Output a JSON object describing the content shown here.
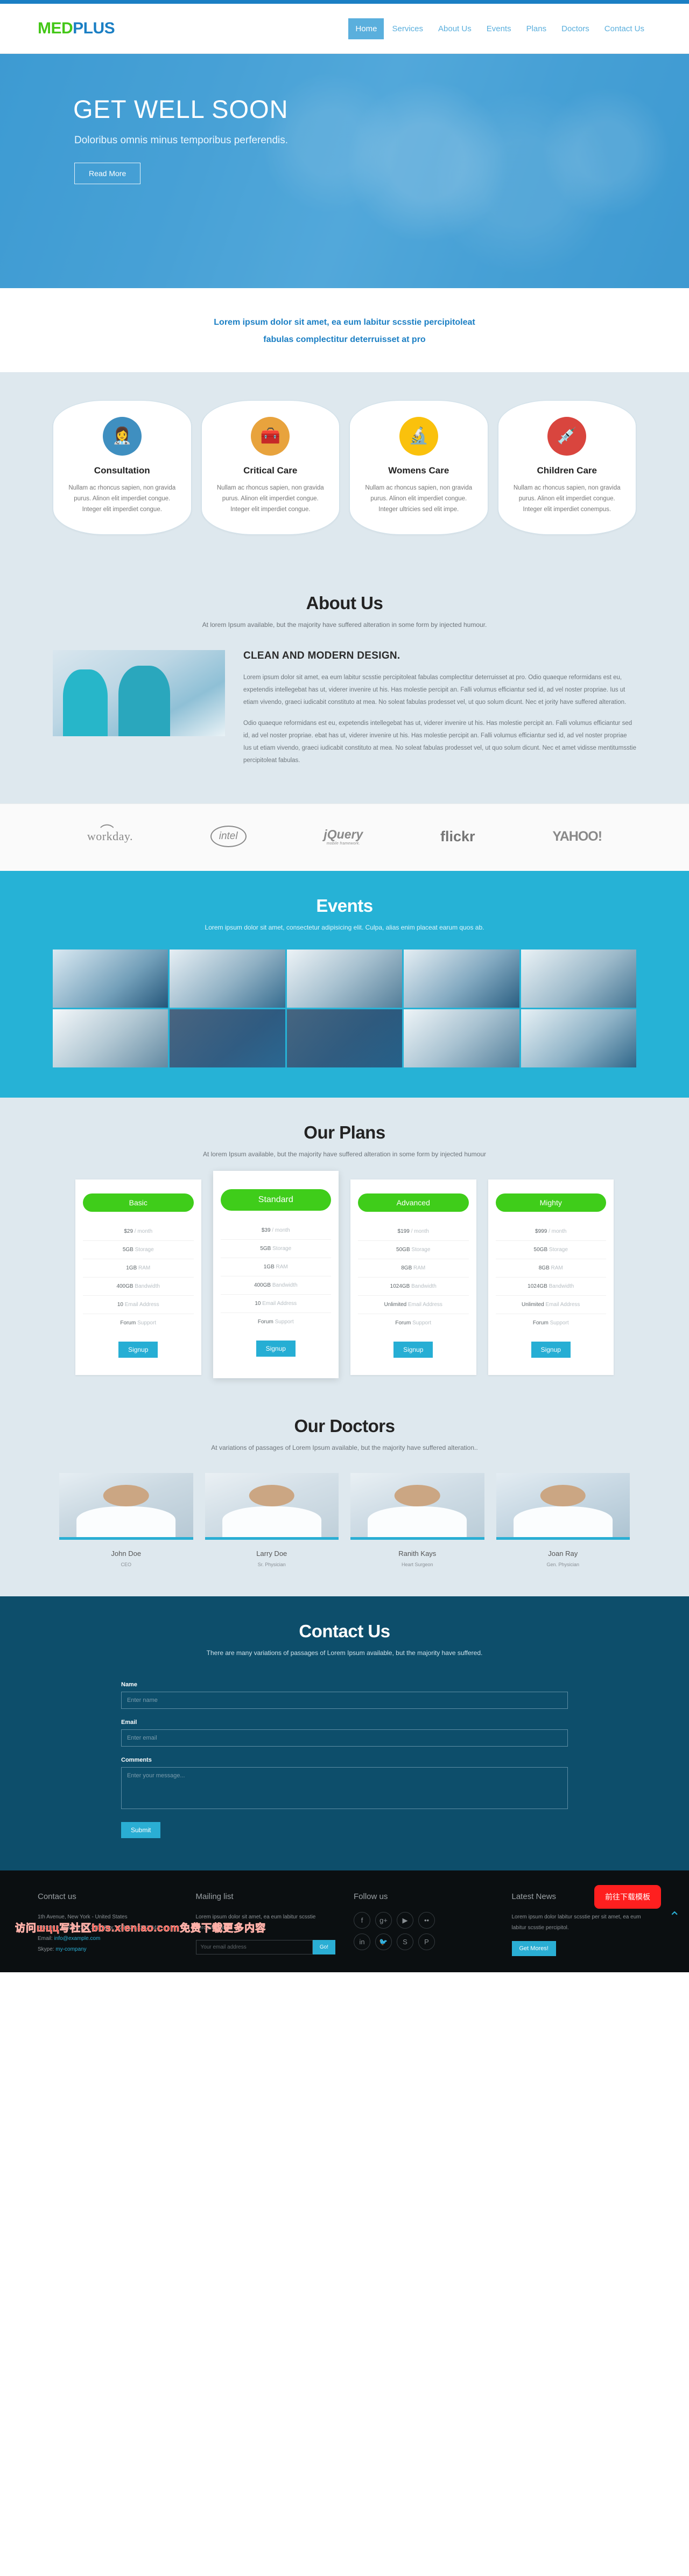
{
  "brand": {
    "part1": "MED",
    "part2": "PLUS",
    "green": "#44c718",
    "blue": "#1b7fc4"
  },
  "nav": {
    "items": [
      {
        "label": "Home",
        "active": true
      },
      {
        "label": "Services",
        "active": false
      },
      {
        "label": "About Us",
        "active": false
      },
      {
        "label": "Events",
        "active": false
      },
      {
        "label": "Plans",
        "active": false
      },
      {
        "label": "Doctors",
        "active": false
      },
      {
        "label": "Contact Us",
        "active": false
      }
    ]
  },
  "hero": {
    "title": "GET WELL SOON",
    "subtitle": "Doloribus omnis minus temporibus perferendis.",
    "button": "Read More"
  },
  "tagline": {
    "line1": "Lorem ipsum dolor sit amet, ea eum labitur scsstie percipitoleat",
    "line2": "fabulas complectitur deterruisset at pro"
  },
  "services": {
    "cards": [
      {
        "icon": "nurse-icon",
        "glyph": "👩‍⚕",
        "color": "#3f8fc0",
        "title": "Consultation",
        "text": "Nullam ac rhoncus sapien, non gravida purus. Alinon elit imperdiet congue. Integer elit imperdiet congue."
      },
      {
        "icon": "medical-bag-icon",
        "glyph": "🧰",
        "color": "#e8a33d",
        "title": "Critical Care",
        "text": "Nullam ac rhoncus sapien, non gravida purus. Alinon elit imperdiet congue. Integer elit imperdiet congue."
      },
      {
        "icon": "microscope-icon",
        "glyph": "🔬",
        "color": "#fac10c",
        "title": "Womens Care",
        "text": "Nullam ac rhoncus sapien, non gravida purus. Alinon elit imperdiet congue. Integer ultricies sed elit impe."
      },
      {
        "icon": "syringe-icon",
        "glyph": "💉",
        "color": "#d9453e",
        "title": "Children Care",
        "text": "Nullam ac rhoncus sapien, non gravida purus. Alinon elit imperdiet congue. Integer elit imperdiet conempus."
      }
    ]
  },
  "about": {
    "title": "About Us",
    "subtitle": "At lorem Ipsum available, but the majority have suffered alteration in some form by injected humour.",
    "heading": "CLEAN AND MODERN DESIGN.",
    "para1": "Lorem ipsum dolor sit amet, ea eum labitur scsstie percipitoleat fabulas complectitur deterruisset at pro. Odio quaeque reformidans est eu, expetendis intellegebat has ut, viderer invenire ut his. Has molestie percipit an. Falli volumus efficiantur sed id, ad vel noster propriae. Ius ut etiam vivendo, graeci iudicabit constituto at mea. No soleat fabulas prodesset vel, ut quo solum dicunt. Nec et jority have suffered alteration.",
    "para2": "Odio quaeque reformidans est eu, expetendis intellegebat has ut, viderer invenire ut his. Has molestie percipit an. Falli volumus efficiantur sed id, ad vel noster propriae. ebat has ut, viderer invenire ut his. Has molestie percipit an. Falli volumus efficiantur sed id, ad vel noster propriae Ius ut etiam vivendo, graeci iudicabit constituto at mea. No soleat fabulas prodesset vel, ut quo solum dicunt. Nec et amet vidisse mentitumsstie percipitoleat fabulas."
  },
  "brands": {
    "items": [
      {
        "name": "workday-logo",
        "text": "workday."
      },
      {
        "name": "intel-logo",
        "text": "intel"
      },
      {
        "name": "jquery-logo",
        "text": "jQuery",
        "sub": "mobile framework."
      },
      {
        "name": "flickr-logo",
        "text": "flickr"
      },
      {
        "name": "yahoo-logo",
        "text": "YAHOO!"
      }
    ]
  },
  "events": {
    "title": "Events",
    "subtitle": "Lorem ipsum dolor sit amet, consectetur adipisicing elit. Culpa, alias enim placeat earum quos ab.",
    "tiles": [
      "operating-room-photo",
      "stethoscope-exam-photo",
      "doctor-consult-photo",
      "doctor-portrait-photo",
      "team-meeting-photo",
      "patient-bed-photo",
      "lab-work-photo",
      "surgery-photo",
      "nurse-patient-photo",
      "smiling-doctor-photo"
    ]
  },
  "plans": {
    "title": "Our Plans",
    "subtitle": "At lorem Ipsum available, but the majority have suffered alteration in some form by injected humour",
    "items": [
      {
        "name": "Basic",
        "featured": false,
        "price": "$29",
        "period": "/ month",
        "storage_v": "5GB",
        "storage_l": "Storage",
        "ram_v": "1GB",
        "ram_l": "RAM",
        "bw_v": "400GB",
        "bw_l": "Bandwidth",
        "email_v": "10",
        "email_l": "Email Address",
        "support_v": "Forum",
        "support_l": "Support",
        "cta": "Signup"
      },
      {
        "name": "Standard",
        "featured": true,
        "price": "$39",
        "period": "/ month",
        "storage_v": "5GB",
        "storage_l": "Storage",
        "ram_v": "1GB",
        "ram_l": "RAM",
        "bw_v": "400GB",
        "bw_l": "Bandwidth",
        "email_v": "10",
        "email_l": "Email Address",
        "support_v": "Forum",
        "support_l": "Support",
        "cta": "Signup"
      },
      {
        "name": "Advanced",
        "featured": false,
        "price": "$199",
        "period": "/ month",
        "storage_v": "50GB",
        "storage_l": "Storage",
        "ram_v": "8GB",
        "ram_l": "RAM",
        "bw_v": "1024GB",
        "bw_l": "Bandwidth",
        "email_v": "Unlimited",
        "email_l": "Email Address",
        "support_v": "Forum",
        "support_l": "Support",
        "cta": "Signup"
      },
      {
        "name": "Mighty",
        "featured": false,
        "price": "$999",
        "period": "/ month",
        "storage_v": "50GB",
        "storage_l": "Storage",
        "ram_v": "8GB",
        "ram_l": "RAM",
        "bw_v": "1024GB",
        "bw_l": "Bandwidth",
        "email_v": "Unlimited",
        "email_l": "Email Address",
        "support_v": "Forum",
        "support_l": "Support",
        "cta": "Signup"
      }
    ]
  },
  "doctors": {
    "title": "Our Doctors",
    "subtitle": "At variations of passages of Lorem Ipsum available, but the majority have suffered alteration..",
    "items": [
      {
        "name": "John Doe",
        "role": "CEO"
      },
      {
        "name": "Larry Doe",
        "role": "Sr. Physician"
      },
      {
        "name": "Ranith Kays",
        "role": "Heart Surgeon"
      },
      {
        "name": "Joan Ray",
        "role": "Gen. Physician"
      }
    ]
  },
  "contact": {
    "title": "Contact Us",
    "subtitle": "There are many variations of passages of Lorem Ipsum available, but the majority have suffered.",
    "name_label": "Name",
    "name_placeholder": "Enter name",
    "email_label": "Email",
    "email_placeholder": "Enter email",
    "comments_label": "Comments",
    "comments_placeholder": "Enter your message...",
    "submit": "Submit"
  },
  "footer": {
    "contact": {
      "title": "Contact us",
      "address": "1th Avenue, New York - United States",
      "phone": "Phone: +22 342 2345 345 | Fax: +22 724 2342 343",
      "email_label": "Email:",
      "email_value": "info@example.com",
      "skype_label": "Skype:",
      "skype_value": "my-company"
    },
    "mailing": {
      "title": "Mailing list",
      "text": "Lorem ipsum dolor sit amet, ea eum labitur scsstie percipitoleat.",
      "placeholder": "Your email address",
      "button": "Go!"
    },
    "follow": {
      "title": "Follow us",
      "icons": [
        {
          "name": "facebook-icon",
          "glyph": "f"
        },
        {
          "name": "google-plus-icon",
          "glyph": "g+"
        },
        {
          "name": "youtube-icon",
          "glyph": "▶"
        },
        {
          "name": "flickr-icon",
          "glyph": "••"
        },
        {
          "name": "linkedin-icon",
          "glyph": "in"
        },
        {
          "name": "twitter-icon",
          "glyph": "🐦"
        },
        {
          "name": "skype-icon",
          "glyph": "S"
        },
        {
          "name": "pinterest-icon",
          "glyph": "P"
        }
      ]
    },
    "news": {
      "title": "Latest News",
      "text": "Lorem ipsum dolor labitur scsstie per sit amet, ea eum labitur scsstie percipitol.",
      "button": "Get Mores!"
    }
  },
  "overlay": {
    "watermark": "访问шцц写社区bbs.xieniao.com免费下载更多内容",
    "download_badge": "前往下载模板",
    "to_top": "⌃"
  }
}
